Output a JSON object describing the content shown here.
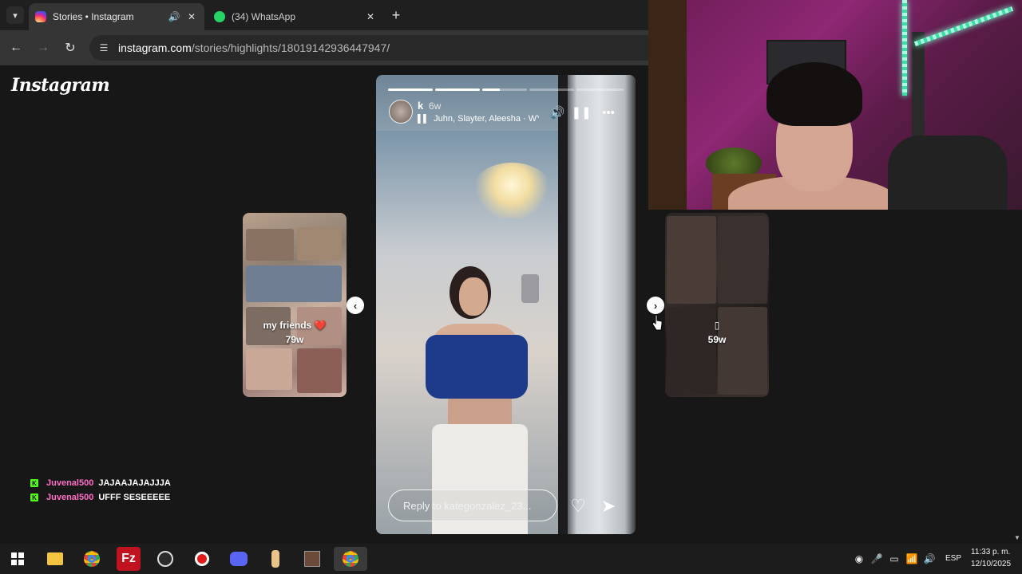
{
  "browser": {
    "tabs": [
      {
        "title": "Stories • Instagram",
        "active": true
      },
      {
        "title": "(34) WhatsApp",
        "active": false
      }
    ],
    "url_host": "instagram.com",
    "url_path": "/stories/highlights/18019142936447947/"
  },
  "page": {
    "logo": "Instagram",
    "prev_preview": {
      "label": "my friends ❤️",
      "age": "79w"
    },
    "next_preview": {
      "label": "▯",
      "age": "59w"
    },
    "story": {
      "username": "k",
      "time": "6w",
      "audio": "Juhn, Slayter, Aleesha · WY...",
      "reply_placeholder": "Reply to kategonzalez_23...",
      "progress": [
        1,
        1,
        0.4,
        0,
        0,
        0
      ],
      "icons": {
        "sound": "speaker-icon",
        "pause": "pause-icon",
        "more": "more-icon",
        "like": "heart-icon",
        "share": "send-icon"
      }
    }
  },
  "chat": [
    {
      "user": "Juvenal500",
      "message": "JAJAAJAJAJJJA"
    },
    {
      "user": "Juvenal500",
      "message": "UFFF SESEEEEE"
    }
  ],
  "taskbar": {
    "lang": "ESP",
    "time": "11:33 p. m.",
    "date": "12/10/2025"
  },
  "colors": {
    "chat_user": "#ff6ec7",
    "kick_green": "#53fc18"
  }
}
